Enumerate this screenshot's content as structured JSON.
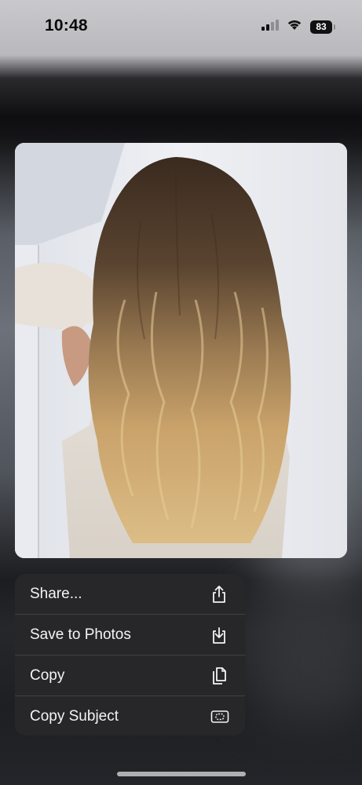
{
  "status_bar": {
    "time": "10:48",
    "battery_level": "83",
    "signal_icon": "cellular-signal-icon",
    "wifi_icon": "wifi-icon"
  },
  "photo": {
    "subject": "long wavy balayage hair viewed from behind",
    "colors": {
      "wall": "#e6e8ee",
      "hair_dark": "#3b2a1e",
      "hair_light": "#d9b57c",
      "sweater": "#e3ddd6"
    }
  },
  "context_menu": {
    "items": [
      {
        "label": "Share...",
        "icon": "share-icon"
      },
      {
        "label": "Save to Photos",
        "icon": "save-to-photos-icon"
      },
      {
        "label": "Copy",
        "icon": "copy-icon"
      },
      {
        "label": "Copy Subject",
        "icon": "copy-subject-icon"
      }
    ]
  }
}
